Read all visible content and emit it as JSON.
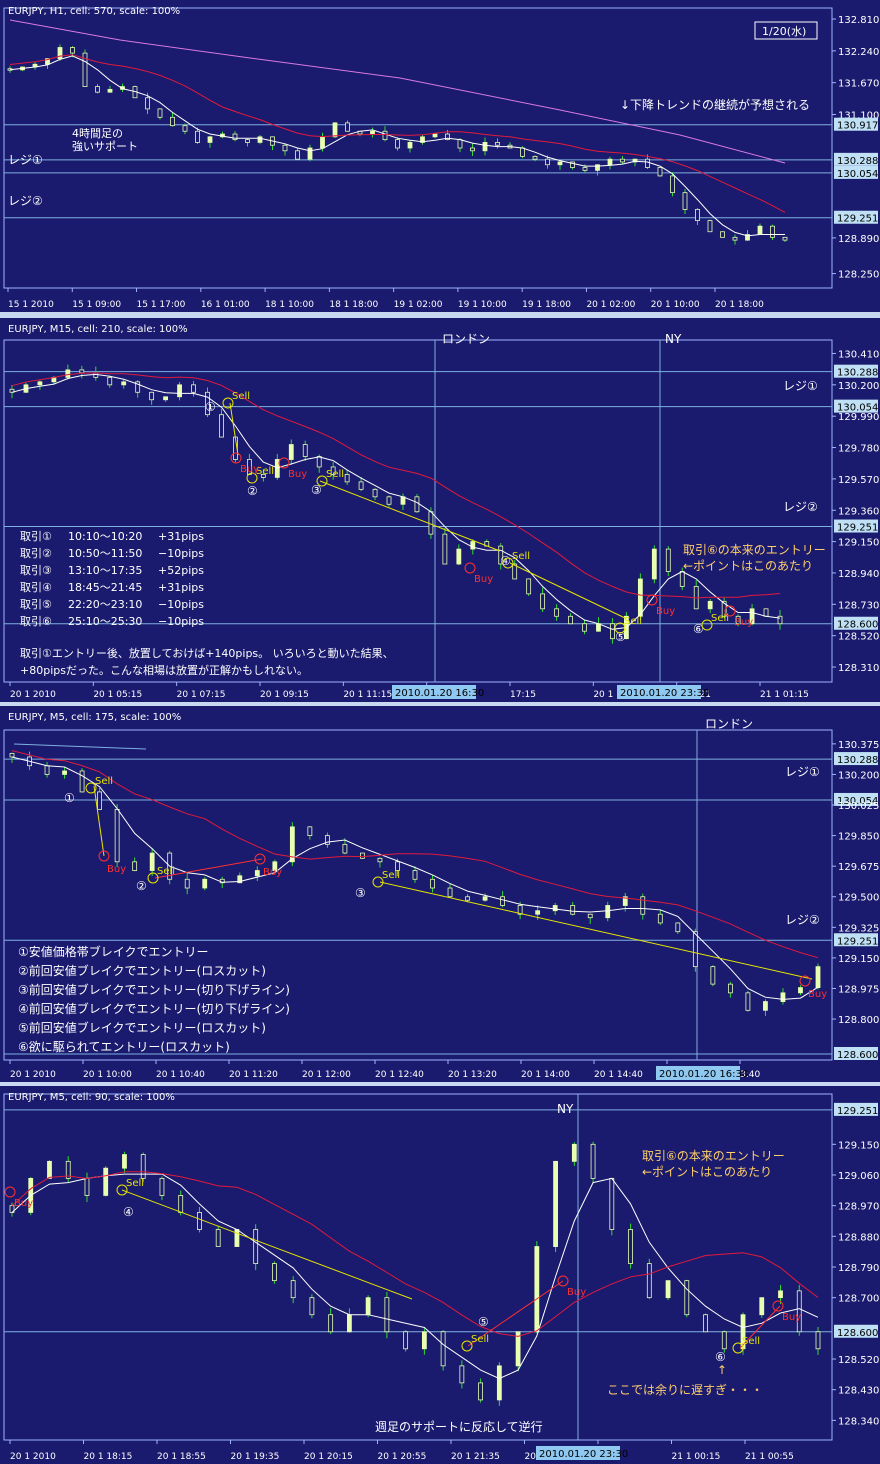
{
  "colors": {
    "background": "#1a1a6e",
    "plot_border": "#9fb4ff",
    "up_candle": "#e8ffb0",
    "down_candle": "#e8ffb0",
    "wick": "#2fdc2f",
    "ma_fast": "#ffffff",
    "ma_mid": "#e01a3c",
    "ma_slow": "#d87ae0",
    "hline": "#7fb0e0",
    "price_tag_bg": "#bfe0f5",
    "trend_line": "#e6e600",
    "sell_color": "#e6e600",
    "buy_color": "#ff3030",
    "annotation_orange": "#ffcf6a",
    "text_white": "#ffffff",
    "crosshair_tag": "#8fc8f0"
  },
  "panels": [
    {
      "id": "h1",
      "header": "EURJPY, H1, cell: 570, scale: 100%",
      "date_badge": "1/20(水)",
      "price_labels": [
        "132.810",
        "132.240",
        "131.670",
        "131.100",
        "130.917",
        "130.288",
        "130.054",
        "129.251",
        "128.890",
        "128.250"
      ],
      "tagged_prices": [
        "130.917",
        "130.288",
        "130.054",
        "129.251"
      ],
      "time_labels": [
        "15 1 2010",
        "15 1 09:00",
        "15 1 17:00",
        "16 1 01:00",
        "18 1 10:00",
        "18 1 18:00",
        "19 1 02:00",
        "19 1 10:00",
        "19 1 18:00",
        "20 1 02:00",
        "20 1 10:00",
        "20 1 18:00"
      ],
      "annotations": {
        "trend": "↓下降トレンドの継続が予想される",
        "support1": "4時間足の",
        "support2": "強いサポート",
        "resi1": "レジ①",
        "resi2": "レジ②"
      }
    },
    {
      "id": "m15",
      "header": "EURJPY, M15, cell: 210, scale: 100%",
      "sessions": [
        "ロンドン",
        "NY"
      ],
      "price_labels": [
        "130.410",
        "130.288",
        "130.200",
        "130.054",
        "129.990",
        "129.780",
        "129.570",
        "129.360",
        "129.251",
        "129.150",
        "128.940",
        "128.730",
        "128.600",
        "128.520",
        "128.310"
      ],
      "tagged_prices": [
        "130.288",
        "130.054",
        "129.251",
        "128.600"
      ],
      "time_labels": [
        "20 1 2010",
        "20 1 05:15",
        "20 1 07:15",
        "20 1 09:15",
        "20 1 11:15",
        "20 1 13:15",
        "17:15",
        "20 1 19:15",
        "20 1 21",
        "21 1 01:15"
      ],
      "crosshair_times": [
        "2010.01.20 16:30",
        "2010.01.20 23:30"
      ],
      "resi1": "レジ①",
      "resi2": "レジ②",
      "trades": [
        {
          "no": "取引①",
          "time": "10:10〜10:20",
          "pips": "+31pips"
        },
        {
          "no": "取引②",
          "time": "10:50〜11:50",
          "pips": "−10pips"
        },
        {
          "no": "取引③",
          "time": "13:10〜17:35",
          "pips": "+52pips"
        },
        {
          "no": "取引④",
          "time": "18:45〜21:45",
          "pips": "+31pips"
        },
        {
          "no": "取引⑤",
          "time": "22:20〜23:10",
          "pips": "−10pips"
        },
        {
          "no": "取引⑥",
          "time": "25:10〜25:30",
          "pips": "−10pips"
        }
      ],
      "summary1": "取引①エントリー後、放置しておけば+140pips。 いろいろと動いた結果、",
      "summary2": "+80pipsだった。こんな相場は放置が正解かもしれない。",
      "entry_note1": "取引⑥の本来のエントリー",
      "entry_note2": "←ポイントはこのあたり",
      "markers": [
        "①",
        "②",
        "③",
        "④",
        "⑤",
        "⑥"
      ],
      "sell": "Sell",
      "buy": "Buy"
    },
    {
      "id": "m5a",
      "header": "EURJPY, M5, cell: 175, scale: 100%",
      "sessions": [
        "ロンドン"
      ],
      "price_labels": [
        "130.375",
        "130.288",
        "130.200",
        "130.054",
        "130.025",
        "129.850",
        "129.675",
        "129.500",
        "129.325",
        "129.251",
        "129.150",
        "128.975",
        "128.800",
        "128.600"
      ],
      "tagged_prices": [
        "130.288",
        "130.054",
        "129.251",
        "128.600"
      ],
      "time_labels": [
        "20 1 2010",
        "20 1 10:00",
        "20 1 10:40",
        "20 1 11:20",
        "20 1 12:00",
        "20 1 12:40",
        "20 1 13:20",
        "20 1 14:00",
        "20 1 14:40",
        "20 1 15:20",
        "3:40"
      ],
      "crosshair_times": [
        "2010.01.20 16:30"
      ],
      "resi1": "レジ①",
      "resi2": "レジ②",
      "legend": [
        "①安値価格帯ブレイクでエントリー",
        "②前回安値ブレイクでエントリー(ロスカット)",
        "③前回安値ブレイクでエントリー(切り下げライン)",
        "④前回安値ブレイクでエントリー(切り下げライン)",
        "⑤前回安値ブレイクでエントリー(ロスカット)",
        "⑥欲に駆られてエントリー(ロスカット)"
      ],
      "markers": [
        "①",
        "②",
        "③"
      ],
      "sell": "Sell",
      "buy": "Buy"
    },
    {
      "id": "m5b",
      "header": "EURJPY, M5, cell: 90, scale: 100%",
      "sessions": [
        "NY"
      ],
      "price_labels": [
        "129.251",
        "129.150",
        "129.060",
        "128.970",
        "128.880",
        "128.790",
        "128.700",
        "128.600",
        "128.520",
        "128.430",
        "128.340"
      ],
      "tagged_prices": [
        "129.251",
        "128.600"
      ],
      "time_labels": [
        "20 1 2010",
        "20 1 18:15",
        "20 1 18:55",
        "20 1 19:35",
        "20 1 20:15",
        "20 1 20:55",
        "20 1 21:35",
        "20 1 22:15",
        "3:35",
        "21 1 00:15",
        "21 1 00:55"
      ],
      "crosshair_times": [
        "2010.01.20 23:30"
      ],
      "entry_note1": "取引⑥の本来のエントリー",
      "entry_note2": "←ポイントはこのあたり",
      "late_arrow": "↑",
      "late_note": "ここでは余りに遅すぎ・・・",
      "support_note": "週足のサポートに反応して逆行",
      "markers": [
        "④",
        "⑤",
        "⑥"
      ],
      "sell": "Sell",
      "buy": "Buy"
    }
  ],
  "chart_data": [
    {
      "type": "candlestick",
      "title": "EURJPY, H1",
      "ylim": [
        128.1,
        132.9
      ],
      "close_path": [
        131.9,
        131.95,
        132.0,
        132.1,
        132.3,
        132.2,
        131.6,
        131.5,
        131.55,
        131.6,
        131.4,
        131.2,
        131.05,
        130.9,
        130.8,
        130.6,
        130.7,
        130.75,
        130.65,
        130.6,
        130.7,
        130.55,
        130.45,
        130.3,
        130.5,
        130.7,
        130.95,
        130.8,
        130.75,
        130.8,
        130.65,
        130.5,
        130.6,
        130.7,
        130.75,
        130.65,
        130.5,
        130.45,
        130.6,
        130.55,
        130.5,
        130.35,
        130.3,
        130.2,
        130.25,
        130.15,
        130.1,
        130.2,
        130.3,
        130.25,
        130.3,
        130.15,
        130.0,
        129.7,
        129.4,
        129.2,
        129.0,
        128.9,
        128.85,
        128.95,
        129.1,
        128.9,
        128.85
      ],
      "hlines": [
        130.917,
        130.288,
        130.054,
        129.251
      ]
    },
    {
      "type": "candlestick",
      "title": "EURJPY, M15",
      "ylim": [
        128.25,
        130.46
      ],
      "close_path": [
        130.15,
        130.2,
        130.22,
        130.25,
        130.3,
        130.28,
        130.25,
        130.2,
        130.22,
        130.15,
        130.1,
        130.12,
        130.2,
        130.15,
        130.0,
        129.85,
        129.7,
        129.6,
        129.58,
        129.7,
        129.8,
        129.72,
        129.65,
        129.6,
        129.55,
        129.5,
        129.45,
        129.4,
        129.45,
        129.35,
        129.2,
        129.0,
        129.1,
        129.15,
        129.12,
        129.0,
        128.9,
        128.8,
        128.7,
        128.65,
        128.6,
        128.55,
        128.6,
        128.5,
        128.65,
        128.9,
        129.1,
        128.95,
        128.85,
        128.7,
        128.75,
        128.65,
        128.6,
        128.7,
        128.65,
        128.6
      ],
      "hlines": [
        130.288,
        130.054,
        129.251,
        128.6
      ]
    },
    {
      "type": "candlestick",
      "title": "EURJPY, M5",
      "ylim": [
        128.6,
        130.42
      ],
      "close_path": [
        130.3,
        130.25,
        130.2,
        130.22,
        130.1,
        130.0,
        129.7,
        129.65,
        129.75,
        129.6,
        129.55,
        129.6,
        129.58,
        129.62,
        129.65,
        129.7,
        129.9,
        129.85,
        129.8,
        129.75,
        129.72,
        129.7,
        129.65,
        129.6,
        129.55,
        129.5,
        129.48,
        129.5,
        129.45,
        129.4,
        129.42,
        129.45,
        129.4,
        129.38,
        129.45,
        129.5,
        129.4,
        129.35,
        129.3,
        129.1,
        129.0,
        128.95,
        128.85,
        128.9,
        128.95,
        128.98,
        129.1
      ],
      "hlines": [
        130.288,
        130.054,
        129.251,
        128.6
      ]
    },
    {
      "type": "candlestick",
      "title": "EURJPY, M5",
      "ylim": [
        128.3,
        129.28
      ],
      "close_path": [
        128.95,
        129.05,
        129.1,
        129.05,
        129.0,
        129.08,
        129.12,
        129.05,
        129.0,
        128.95,
        128.9,
        128.85,
        128.9,
        128.8,
        128.75,
        128.7,
        128.65,
        128.6,
        128.65,
        128.7,
        128.6,
        128.55,
        128.6,
        128.5,
        128.45,
        128.4,
        128.5,
        128.6,
        128.85,
        129.1,
        129.15,
        129.05,
        128.9,
        128.8,
        128.7,
        128.75,
        128.65,
        128.6,
        128.55,
        128.65,
        128.7,
        128.72,
        128.6,
        128.55
      ],
      "hlines": [
        129.251,
        128.6
      ]
    }
  ]
}
